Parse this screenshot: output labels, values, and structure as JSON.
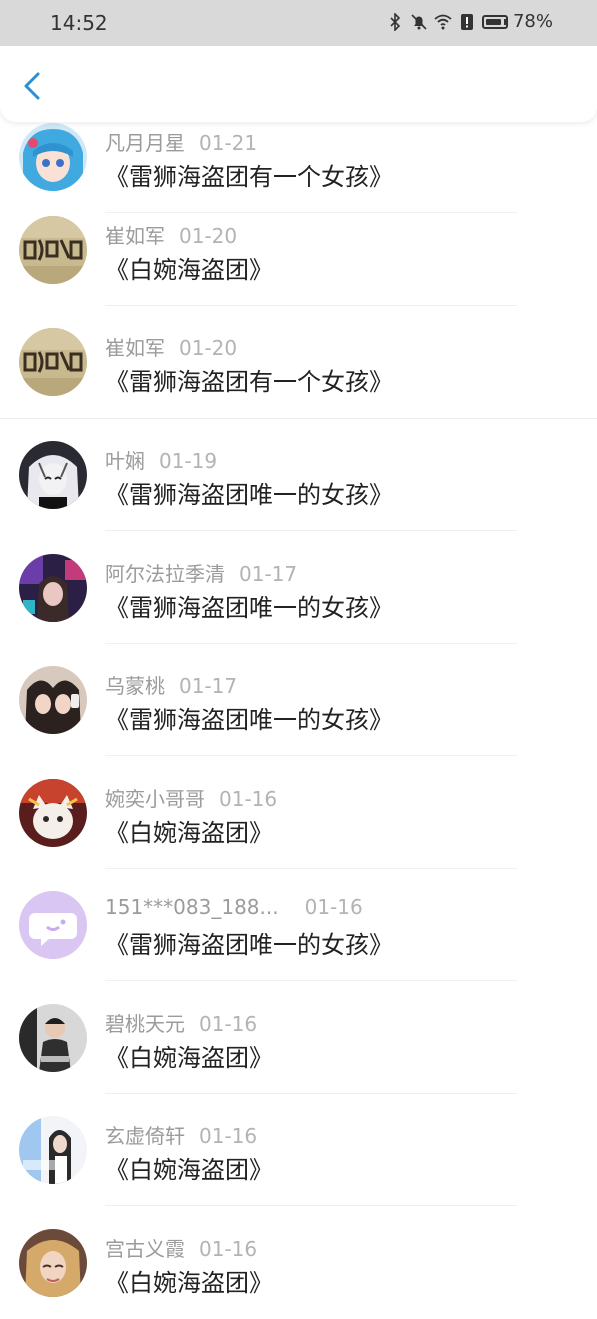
{
  "status": {
    "time": "14:52",
    "battery": "78%"
  },
  "rows": [
    {
      "name": "凡月月星",
      "date": "01-21",
      "title": "《雷狮海盗团有一个女孩》",
      "avatar": "anime-blue-hair"
    },
    {
      "name": "崔如军",
      "date": "01-20",
      "title": "《白婉海盗团》",
      "avatar": "calligraphy"
    },
    {
      "name": "崔如军",
      "date": "01-20",
      "title": "《雷狮海盗团有一个女孩》",
      "avatar": "calligraphy"
    },
    {
      "name": "叶娴",
      "date": "01-19",
      "title": "《雷狮海盗团唯一的女孩》",
      "avatar": "anime-girl-dark"
    },
    {
      "name": "阿尔法拉季清",
      "date": "01-17",
      "title": "《雷狮海盗团唯一的女孩》",
      "avatar": "anime-night"
    },
    {
      "name": "乌蒙桃",
      "date": "01-17",
      "title": "《雷狮海盗团唯一的女孩》",
      "avatar": "photo-girls"
    },
    {
      "name": "婉奕小哥哥",
      "date": "01-16",
      "title": "《白婉海盗团》",
      "avatar": "cat-toy"
    },
    {
      "name": "151***083_188...",
      "date": "01-16",
      "title": "《雷狮海盗团唯一的女孩》",
      "avatar": "default-chat"
    },
    {
      "name": "碧桃天元",
      "date": "01-16",
      "title": "《白婉海盗团》",
      "avatar": "photo-boy"
    },
    {
      "name": "玄虚倚轩",
      "date": "01-16",
      "title": "《白婉海盗团》",
      "avatar": "photo-girl-blue"
    },
    {
      "name": "宫古义霞",
      "date": "01-16",
      "title": "《白婉海盗团》",
      "avatar": "photo-blonde"
    }
  ]
}
